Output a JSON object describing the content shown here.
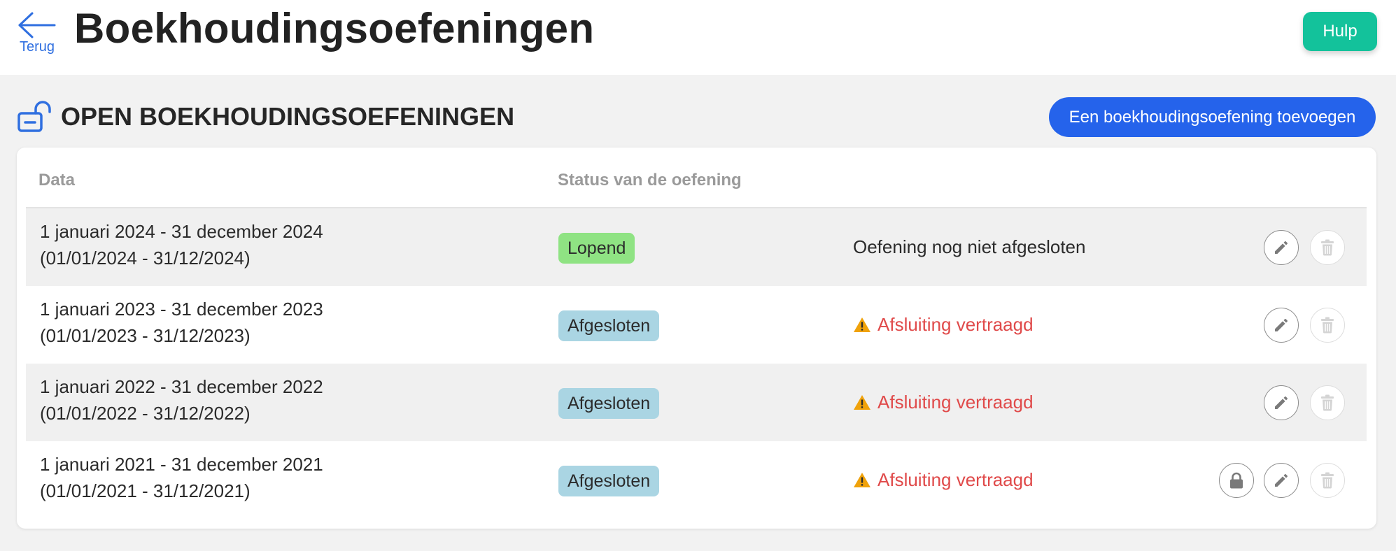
{
  "header": {
    "back_label": "Terug",
    "title": "Boekhoudingsoefeningen",
    "help_label": "Hulp"
  },
  "section": {
    "icon": "open-lock-icon",
    "title": "OPEN BOEKHOUDINGSOEFENINGEN",
    "add_button_label": "Een boekhoudingsoefening toevoegen"
  },
  "table": {
    "columns": [
      "Data",
      "Status van de oefening"
    ],
    "rows": [
      {
        "date_long": "1 januari 2024 - 31 december 2024",
        "date_short": "(01/01/2024 - 31/12/2024)",
        "status": "Lopend",
        "note": "Oefening nog niet afgesloten",
        "warning": false,
        "actions": [
          "edit",
          "delete"
        ]
      },
      {
        "date_long": "1 januari 2023 - 31 december 2023",
        "date_short": "(01/01/2023 - 31/12/2023)",
        "status": "Afgesloten",
        "note": "Afsluiting vertraagd",
        "warning": true,
        "actions": [
          "edit",
          "delete"
        ]
      },
      {
        "date_long": "1 januari 2022 - 31 december 2022",
        "date_short": "(01/01/2022 - 31/12/2022)",
        "status": "Afgesloten",
        "note": "Afsluiting vertraagd",
        "warning": true,
        "actions": [
          "edit",
          "delete"
        ]
      },
      {
        "date_long": "1 januari 2021 - 31 december 2021",
        "date_short": "(01/01/2021 - 31/12/2021)",
        "status": "Afgesloten",
        "note": "Afsluiting vertraagd",
        "warning": true,
        "actions": [
          "lock",
          "edit",
          "delete"
        ]
      }
    ]
  },
  "colors": {
    "primary_blue": "#2563eb",
    "help_green": "#13c29b",
    "status_running": "#8fe383",
    "status_closed": "#aad5e3",
    "warning_red": "#e04a4a",
    "warning_amber": "#f0a20a"
  }
}
